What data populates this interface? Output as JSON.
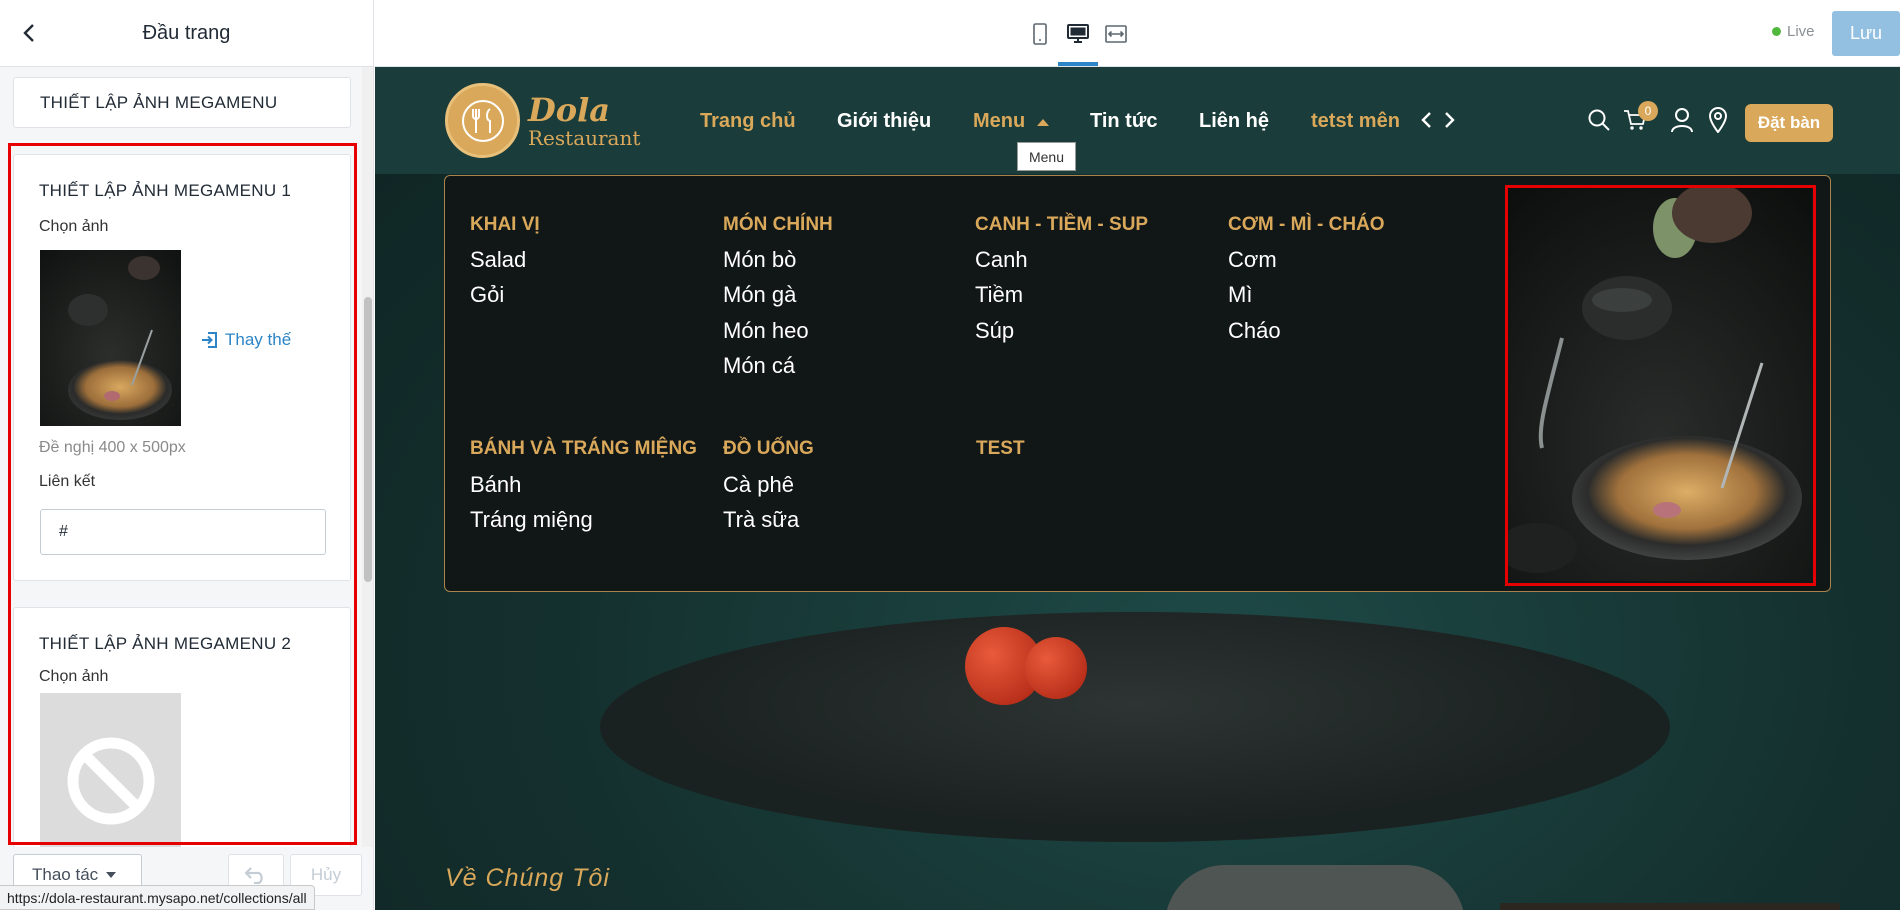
{
  "sidebar": {
    "title": "Đầu trang",
    "collapsed_section": "THIẾT LẬP ẢNH MEGAMENU",
    "section1": {
      "title": "THIẾT LẬP ẢNH MEGAMENU 1",
      "choose_image": "Chọn ảnh",
      "replace": "Thay thế",
      "hint": "Đề nghị 400 x 500px",
      "link_label": "Liên kết",
      "link_value": "#"
    },
    "section2": {
      "title": "THIẾT LẬP ẢNH MEGAMENU 2",
      "choose_image": "Chọn ảnh"
    },
    "footer": {
      "actions": "Thao tác",
      "cancel": "Hủy"
    }
  },
  "toolbar": {
    "live": "Live",
    "save": "Lưu"
  },
  "site": {
    "logo_line1": "Dola",
    "logo_line2": "Restaurant",
    "nav": {
      "home": "Trang chủ",
      "about": "Giới thiệu",
      "menu": "Menu",
      "news": "Tin tức",
      "contact": "Liên hệ",
      "test": "tetst mên"
    },
    "tooltip": "Menu",
    "cart_count": "0",
    "book": "Đặt bàn",
    "about_heading": "Về Chúng Tôi"
  },
  "megamenu": {
    "khaivi": {
      "title": "KHAI VỊ",
      "items": [
        "Salad",
        "Gỏi"
      ]
    },
    "monchinh": {
      "title": "MÓN CHÍNH",
      "items": [
        "Món bò",
        "Món gà",
        "Món heo",
        "Món cá"
      ]
    },
    "canh": {
      "title": "CANH - TIỀM - SUP",
      "items": [
        "Canh",
        "Tiềm",
        "Súp"
      ]
    },
    "com": {
      "title": "CƠM - MÌ - CHÁO",
      "items": [
        "Cơm",
        "Mì",
        "Cháo"
      ]
    },
    "banh": {
      "title": "BÁNH VÀ TRÁNG MIỆNG",
      "items": [
        "Bánh",
        "Tráng miệng"
      ]
    },
    "douong": {
      "title": "ĐỒ UỐNG",
      "items": [
        "Cà phê",
        "Trà sữa"
      ]
    },
    "test": {
      "title": "TEST"
    }
  },
  "status_url": "https://dola-restaurant.mysapo.net/collections/all"
}
